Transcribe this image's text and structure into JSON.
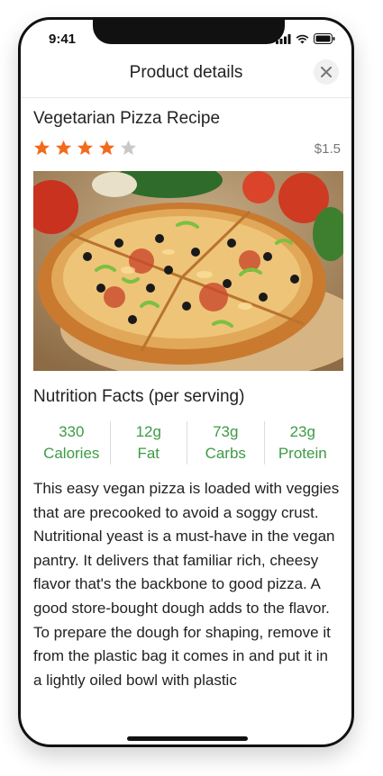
{
  "status_bar": {
    "time": "9:41"
  },
  "nav": {
    "title": "Product details"
  },
  "product": {
    "title": "Vegetarian Pizza Recipe",
    "rating": 4,
    "rating_max": 5,
    "price": "$1.5",
    "image_subject": "pizza"
  },
  "nutrition": {
    "title": "Nutrition Facts (per serving)",
    "items": [
      {
        "value": "330",
        "label": "Calories"
      },
      {
        "value": "12g",
        "label": "Fat"
      },
      {
        "value": "73g",
        "label": "Carbs"
      },
      {
        "value": "23g",
        "label": "Protein"
      }
    ]
  },
  "description": "This easy vegan pizza is loaded with veggies that are precooked to avoid a soggy crust. Nutritional yeast is a must-have in the vegan pantry. It delivers that familiar rich, cheesy flavor that's the backbone to good pizza. A good store-bought dough adds to the flavor. To prepare the dough for shaping, remove it from the plastic bag it comes in and put it in a lightly oiled bowl with plastic",
  "colors": {
    "star_filled": "#f26a1b",
    "star_empty": "#c8c8c8",
    "nutrition_text": "#3d9b45"
  },
  "icons": {
    "close": "close-icon",
    "signal": "signal-icon",
    "wifi": "wifi-icon",
    "battery": "battery-icon",
    "star": "star-icon"
  }
}
